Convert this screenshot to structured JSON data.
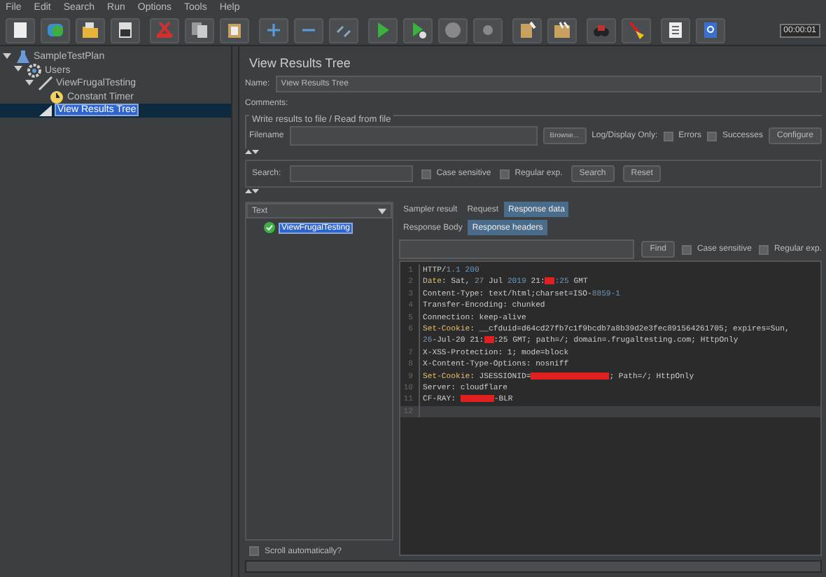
{
  "menu": [
    "File",
    "Edit",
    "Search",
    "Run",
    "Options",
    "Tools",
    "Help"
  ],
  "toolbar": {
    "timer": "00:00:01"
  },
  "tree": [
    {
      "label": "SampleTestPlan",
      "kind": "plan",
      "expanded": true,
      "selected": false,
      "children": [
        {
          "label": "Users",
          "kind": "group",
          "expanded": true,
          "selected": false,
          "children": [
            {
              "label": "ViewFrugalTesting",
              "kind": "sampler",
              "expanded": true,
              "selected": false,
              "children": [
                {
                  "label": "Constant Timer",
                  "kind": "timer",
                  "selected": false
                }
              ]
            },
            {
              "label": "View Results Tree",
              "kind": "listener",
              "selected": true
            }
          ]
        }
      ]
    }
  ],
  "panel": {
    "title": "View Results Tree",
    "name_label": "Name:",
    "name_value": "View Results Tree",
    "comments_label": "Comments:",
    "file_group": {
      "title": "Write results to file / Read from file",
      "filename_label": "Filename",
      "browse": "Browse...",
      "log_label": "Log/Display Only:",
      "errors": {
        "label": "Errors",
        "checked": false
      },
      "successes": {
        "label": "Successes",
        "checked": false
      },
      "configure": "Configure"
    },
    "search": {
      "label": "Search:",
      "case_sensitive": {
        "label": "Case sensitive",
        "checked": false
      },
      "regular_exp": {
        "label": "Regular exp.",
        "checked": false
      },
      "search_button": "Search",
      "reset_button": "Reset"
    }
  },
  "results": {
    "renderer": "Text",
    "items": [
      {
        "label": "ViewFrugalTesting",
        "selected": true
      }
    ],
    "scroll_automatically": {
      "label": "Scroll automatically?",
      "checked": false
    }
  },
  "tabs": [
    {
      "label": "Sampler result",
      "selected": false
    },
    {
      "label": "Request",
      "selected": false
    },
    {
      "label": "Response data",
      "selected": true
    }
  ],
  "subtabs": [
    {
      "label": "Response Body",
      "selected": false
    },
    {
      "label": "Response headers",
      "selected": true
    }
  ],
  "find": {
    "button": "Find",
    "case_sensitive": {
      "label": "Case sensitive",
      "checked": false
    },
    "regular_exp": {
      "label": "Regular exp.",
      "checked": false
    }
  },
  "code": [
    {
      "number": "1",
      "current": false,
      "rows": [
        [
          {
            "kind": "plain",
            "text": "HTTP/"
          },
          {
            "kind": "num",
            "text": "1.1 200"
          }
        ]
      ]
    },
    {
      "number": "2",
      "current": false,
      "rows": [
        [
          {
            "kind": "key",
            "text": "Date"
          },
          {
            "kind": "plain",
            "text": ": Sat, "
          },
          {
            "kind": "num",
            "text": "27"
          },
          {
            "kind": "plain",
            "text": " Jul "
          },
          {
            "kind": "num",
            "text": "2019"
          },
          {
            "kind": "plain",
            "text": " 21:"
          },
          {
            "kind": "redacted"
          },
          {
            "kind": "num",
            "text": ":25"
          },
          {
            "kind": "plain",
            "text": " GMT"
          }
        ]
      ]
    },
    {
      "number": "3",
      "current": false,
      "rows": [
        [
          {
            "kind": "plain",
            "text": "Content-Type: text/html;charset=ISO-"
          },
          {
            "kind": "num",
            "text": "8859-1"
          }
        ]
      ]
    },
    {
      "number": "4",
      "current": false,
      "rows": [
        [
          {
            "kind": "plain",
            "text": "Transfer-Encoding: chunked"
          }
        ]
      ]
    },
    {
      "number": "5",
      "current": false,
      "rows": [
        [
          {
            "kind": "plain",
            "text": "Connection: keep-alive"
          }
        ]
      ]
    },
    {
      "number": "6",
      "current": false,
      "rows": [
        [
          {
            "kind": "key",
            "text": "Set-Cookie"
          },
          {
            "kind": "plain",
            "text": ": __cfduid=d64cd27fb7c1f9bcdb7a8b39d2e3fec891564261705; expires=Sun,"
          }
        ],
        [
          {
            "kind": "num",
            "text": "26"
          },
          {
            "kind": "plain",
            "text": "-Jul-20 21:"
          },
          {
            "kind": "redacted"
          },
          {
            "kind": "plain",
            "text": ":25 GMT; path=/; domain=.frugaltesting.com; HttpOnly"
          }
        ]
      ]
    },
    {
      "number": "7",
      "current": false,
      "rows": [
        [
          {
            "kind": "plain",
            "text": "X-XSS-Protection: 1; mode=block"
          }
        ]
      ]
    },
    {
      "number": "8",
      "current": false,
      "rows": [
        [
          {
            "kind": "plain",
            "text": "X-Content-Type-Options: nosniff"
          }
        ]
      ]
    },
    {
      "number": "9",
      "current": false,
      "rows": [
        [
          {
            "kind": "key",
            "text": "Set-Cookie"
          },
          {
            "kind": "plain",
            "text": ": JSESSIONID="
          },
          {
            "kind": "redactedlong"
          },
          {
            "kind": "plain",
            "text": "; Path=/; HttpOnly"
          }
        ]
      ]
    },
    {
      "number": "10",
      "current": false,
      "rows": [
        [
          {
            "kind": "plain",
            "text": "Server: cloudflare"
          }
        ]
      ]
    },
    {
      "number": "11",
      "current": false,
      "rows": [
        [
          {
            "kind": "plain",
            "text": "CF-RAY: "
          },
          {
            "kind": "redactedmid"
          },
          {
            "kind": "plain",
            "text": "-BLR"
          }
        ]
      ]
    },
    {
      "number": "12",
      "current": true,
      "rows": [
        []
      ]
    }
  ]
}
